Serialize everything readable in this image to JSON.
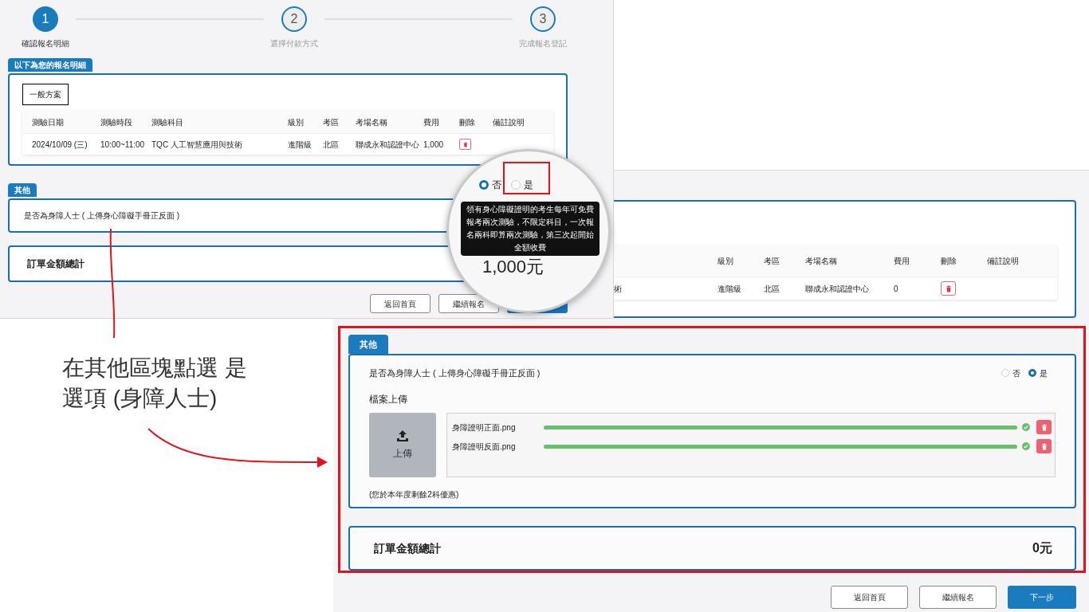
{
  "before_screen": {
    "steps": [
      {
        "number": "1",
        "label": "確認報名明細",
        "active": true
      },
      {
        "number": "2",
        "label": "選擇付款方式",
        "active": false
      },
      {
        "number": "3",
        "label": "完成報名登記",
        "active": false
      }
    ],
    "details_section": {
      "tab": "以下為您的報名明細",
      "plan": "一般方案",
      "columns": [
        "測驗日期",
        "測驗時段",
        "測驗科目",
        "級別",
        "考區",
        "考場名稱",
        "費用",
        "刪除",
        "備註說明"
      ],
      "rows": [
        [
          "2024/10/09 (三)",
          "10:00~11:00",
          "TQC 人工智慧應用與技術",
          "進階級",
          "北區",
          "聯成永和認證中心",
          "1,000"
        ]
      ]
    },
    "other_section": {
      "tab": "其他",
      "question": "是否為身障人士 ( 上傳身心障礙手冊正反面 )"
    },
    "total": {
      "label": "訂單金額總計"
    },
    "buttons": [
      {
        "label": "返回首頁",
        "primary": false
      },
      {
        "label": "繼續報名",
        "primary": false
      },
      {
        "primary": true
      }
    ]
  },
  "magnifier": {
    "options": [
      {
        "label": "否",
        "selected": true,
        "callout_frame": false
      },
      {
        "label": "是",
        "selected": false,
        "callout_frame": true
      }
    ],
    "tooltip": "領有身心障礙證明的考生每年可免費報考兩次測驗，不限定科目，一次報名兩科即算兩次測驗，第三次起開始全額收費",
    "total_amount": "1,000元"
  },
  "instruction": {
    "lines": [
      "在其他區塊點選 是",
      "選項 (身障人士)"
    ]
  },
  "after_screen": {
    "details_table": {
      "columns": [
        "級別",
        "考區",
        "考場名稱",
        "費用",
        "刪除",
        "備註說明"
      ],
      "rows": [
        {
          "cut_cell": "術",
          "cells": [
            "進階級",
            "北區",
            "聯成永和認證中心",
            "0"
          ]
        }
      ]
    },
    "other_section": {
      "tab": "其他",
      "question": "是否為身障人士 ( 上傳身心障礙手冊正反面 )",
      "options": [
        {
          "label": "否",
          "selected": false
        },
        {
          "label": "是",
          "selected": true
        }
      ],
      "upload_label": "檔案上傳",
      "upload_button": "上傳",
      "files": [
        {
          "name": "身障證明正面.png",
          "level": 1
        },
        {
          "name": "身障證明反面.png",
          "level": 1
        }
      ],
      "note": "(您於本年度剩餘2科優惠)"
    },
    "total": {
      "label": "訂單金額總計",
      "amount": "0元"
    },
    "buttons": [
      {
        "label": "返回首頁",
        "primary": false
      },
      {
        "label": "繼續報名",
        "primary": false
      },
      {
        "label": "下一步",
        "primary": true
      }
    ]
  }
}
